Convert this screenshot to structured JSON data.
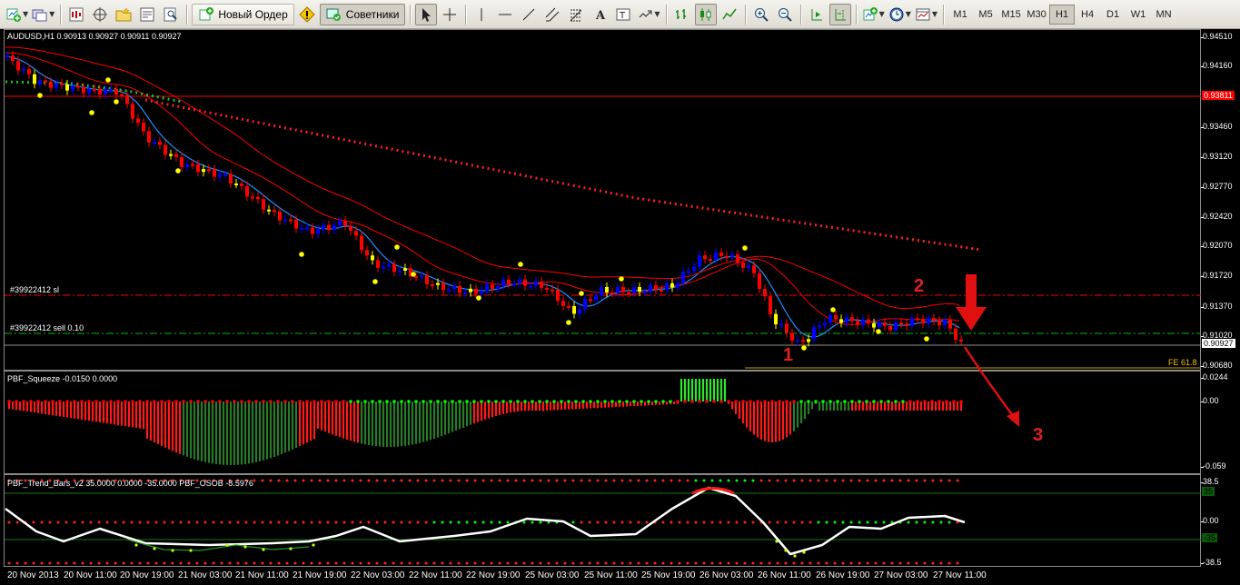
{
  "toolbar": {
    "new_order_label": "Новый Ордер",
    "advisors_label": "Советники",
    "timeframes": [
      "M1",
      "M5",
      "M15",
      "M30",
      "H1",
      "H4",
      "D1",
      "W1",
      "MN"
    ],
    "active_timeframe": "H1"
  },
  "main_chart": {
    "header": "AUDUSD,H1  0.90913 0.90927 0.90911 0.90927",
    "sl_label": "#39922412 sl",
    "order_label": "#39922412 sell 0.10",
    "fe_label": "FE 61.8",
    "current_price": "0.90927",
    "level_price": "0.93811",
    "price_ticks": [
      "0.94510",
      "0.94160",
      "0.93460",
      "0.93120",
      "0.92770",
      "0.92420",
      "0.92070",
      "0.91720",
      "0.91370",
      "0.91020",
      "0.90680"
    ],
    "annotations": [
      "1",
      "2",
      "3"
    ],
    "colors": {
      "bull": "#0000ff",
      "bear": "#ff0000",
      "neutral": "#ffff00",
      "ma": "#ff0000",
      "ma_fast": "#1e90ff",
      "dots": "#ffff00"
    }
  },
  "squeeze": {
    "header": "PBF_Squeeze -0.0150 0.0000",
    "ticks": [
      "0.0244",
      "0.00",
      "-0.059"
    ],
    "colors": {
      "positive": "#32cd32",
      "negative": "#ff0000",
      "dot_on": "#00ff00",
      "dot_off": "#ff0000"
    }
  },
  "trend_bars": {
    "header": "PBF_Trend_Bars_v2 35.0000 0.0000 -35.0000  PBF_OSOB -8.5976",
    "ticks": [
      "38.5",
      "0.00",
      "-38.5"
    ],
    "level_marks": [
      "35",
      "-35"
    ]
  },
  "time_axis": [
    "20 Nov 2013",
    "20 Nov 11:00",
    "20 Nov 19:00",
    "21 Nov 03:00",
    "21 Nov 11:00",
    "21 Nov 19:00",
    "22 Nov 03:00",
    "22 Nov 11:00",
    "22 Nov 19:00",
    "25 Nov 03:00",
    "25 Nov 11:00",
    "25 Nov 19:00",
    "26 Nov 03:00",
    "26 Nov 11:00",
    "26 Nov 19:00",
    "27 Nov 03:00",
    "27 Nov 11:00"
  ]
}
